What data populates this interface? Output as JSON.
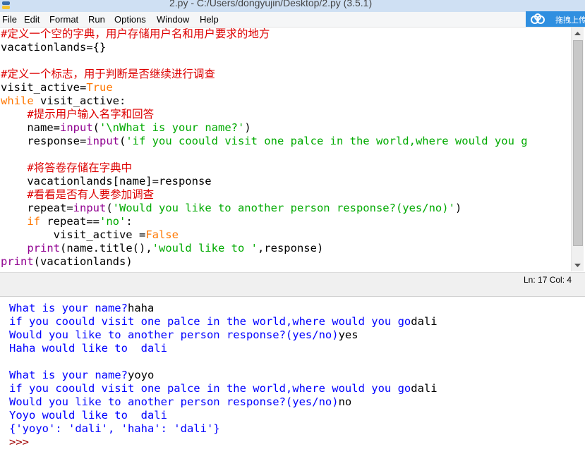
{
  "window": {
    "title": "2.py - C:/Users/dongyujin/Desktop/2.py (3.5.1)"
  },
  "menu": {
    "items": [
      "File",
      "Edit",
      "Format",
      "Run",
      "Options",
      "Window",
      "Help"
    ]
  },
  "cloud_widget": {
    "label": "拖拽上传",
    "icon": "cloud-upload-icon"
  },
  "editor": {
    "lines": [
      [
        {
          "t": "#定义一个空的字典，用户存储用户名和用户要求的地方",
          "c": "cm"
        }
      ],
      [
        {
          "t": "vacationlands={}",
          "c": ""
        }
      ],
      [],
      [
        {
          "t": "#定义一个标志，用于判断是否继续进行调查",
          "c": "cm"
        }
      ],
      [
        {
          "t": "visit_active=",
          "c": ""
        },
        {
          "t": "True",
          "c": "kw"
        }
      ],
      [
        {
          "t": "while",
          "c": "kw"
        },
        {
          "t": " visit_active:",
          "c": ""
        }
      ],
      [
        {
          "t": "    ",
          "c": ""
        },
        {
          "t": "#提示用户输入名字和回答",
          "c": "cm"
        }
      ],
      [
        {
          "t": "    name=",
          "c": ""
        },
        {
          "t": "input",
          "c": "bi"
        },
        {
          "t": "(",
          "c": ""
        },
        {
          "t": "'\\nWhat is your name?'",
          "c": "st"
        },
        {
          "t": ")",
          "c": ""
        }
      ],
      [
        {
          "t": "    response=",
          "c": ""
        },
        {
          "t": "input",
          "c": "bi"
        },
        {
          "t": "(",
          "c": ""
        },
        {
          "t": "'if you coould visit one palce in the world,where would you g",
          "c": "st"
        }
      ],
      [],
      [
        {
          "t": "    ",
          "c": ""
        },
        {
          "t": "#将答卷存储在字典中",
          "c": "cm"
        }
      ],
      [
        {
          "t": "    vacationlands[name]=response",
          "c": ""
        }
      ],
      [
        {
          "t": "    ",
          "c": ""
        },
        {
          "t": "#看看是否有人要参加调查",
          "c": "cm"
        }
      ],
      [
        {
          "t": "    repeat=",
          "c": ""
        },
        {
          "t": "input",
          "c": "bi"
        },
        {
          "t": "(",
          "c": ""
        },
        {
          "t": "'Would you like to another person response?(yes/no)'",
          "c": "st"
        },
        {
          "t": ")",
          "c": ""
        }
      ],
      [
        {
          "t": "    ",
          "c": ""
        },
        {
          "t": "if",
          "c": "kw"
        },
        {
          "t": " repeat==",
          "c": ""
        },
        {
          "t": "'no'",
          "c": "st"
        },
        {
          "t": ":",
          "c": ""
        }
      ],
      [
        {
          "t": "        visit_active =",
          "c": ""
        },
        {
          "t": "False",
          "c": "kw"
        }
      ],
      [
        {
          "t": "    ",
          "c": ""
        },
        {
          "t": "print",
          "c": "bi"
        },
        {
          "t": "(name.title(),",
          "c": ""
        },
        {
          "t": "'would like to '",
          "c": "st"
        },
        {
          "t": ",response)",
          "c": ""
        }
      ],
      [
        {
          "t": "print",
          "c": "bi"
        },
        {
          "t": "(vacationlands)",
          "c": ""
        }
      ]
    ]
  },
  "status": {
    "position": "Ln: 17   Col: 4"
  },
  "shell": {
    "lines": [
      [
        {
          "t": "What is your name?",
          "c": "so"
        },
        {
          "t": "haha",
          "c": "ui"
        }
      ],
      [
        {
          "t": "if you coould visit one palce in the world,where would you go",
          "c": "so"
        },
        {
          "t": "dali",
          "c": "ui"
        }
      ],
      [
        {
          "t": "Would you like to another person response?(yes/no)",
          "c": "so"
        },
        {
          "t": "yes",
          "c": "ui"
        }
      ],
      [
        {
          "t": "Haha would like to  dali",
          "c": "so"
        }
      ],
      [],
      [
        {
          "t": "What is your name?",
          "c": "so"
        },
        {
          "t": "yoyo",
          "c": "ui"
        }
      ],
      [
        {
          "t": "if you coould visit one palce in the world,where would you go",
          "c": "so"
        },
        {
          "t": "dali",
          "c": "ui"
        }
      ],
      [
        {
          "t": "Would you like to another person response?(yes/no)",
          "c": "so"
        },
        {
          "t": "no",
          "c": "ui"
        }
      ],
      [
        {
          "t": "Yoyo would like to  dali",
          "c": "so"
        }
      ],
      [
        {
          "t": "{'yoyo': 'dali', 'haha': 'dali'}",
          "c": "so"
        }
      ],
      [
        {
          "t": ">>> ",
          "c": "prompt"
        }
      ]
    ]
  }
}
